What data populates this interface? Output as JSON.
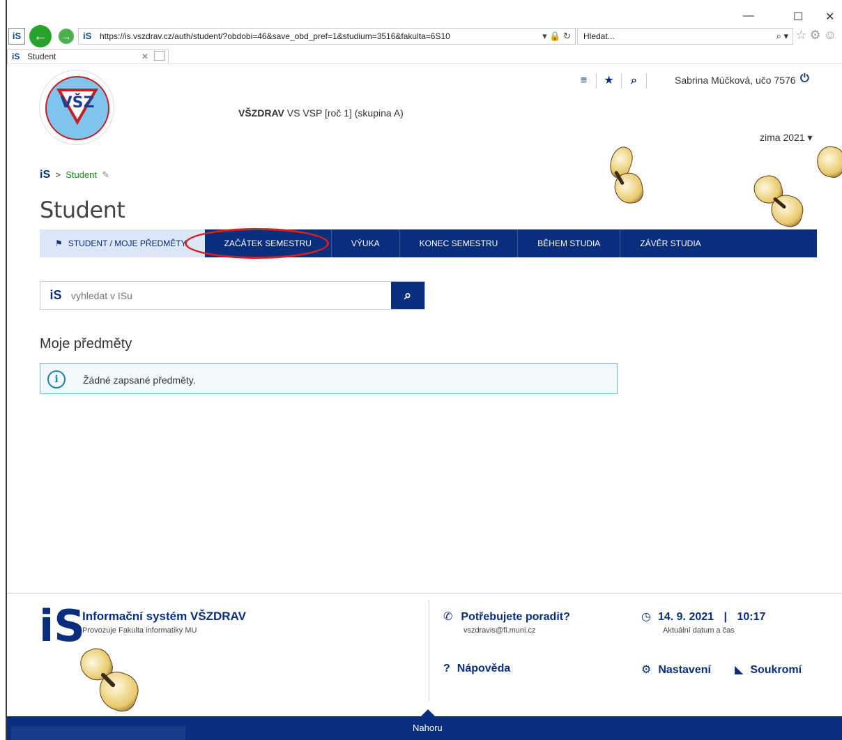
{
  "browser": {
    "url": "https://is.vszdrav.cz/auth/student/?obdobi=46&save_obd_pref=1&studium=3516&fakulta=6S10",
    "search_placeholder": "Hledat...",
    "tab_title": "Student",
    "tab_favicon": "iS"
  },
  "header": {
    "logo_text": "VŠZ",
    "user": "Sabrina Múčková, učo 7576",
    "study_bold": "VŠZDRAV",
    "study_rest": "VS VSP [roč 1] (skupina A)",
    "season": "zima 2021"
  },
  "breadcrumb": {
    "home": "iS",
    "current": "Student"
  },
  "page_title": "Student",
  "nav": {
    "items": [
      {
        "label": "STUDENT / MOJE PŘEDMĚTY",
        "active": true
      },
      {
        "label": "ZAČÁTEK SEMESTRU",
        "active": false
      },
      {
        "label": "VÝUKA",
        "active": false
      },
      {
        "label": "KONEC SEMESTRU",
        "active": false
      },
      {
        "label": "BĚHEM STUDIA",
        "active": false
      },
      {
        "label": "ZÁVĚR STUDIA",
        "active": false
      }
    ]
  },
  "search": {
    "placeholder": "vyhledat v ISu",
    "icon": "iS"
  },
  "section": {
    "title": "Moje předměty",
    "info_text": "Žádné zapsané předměty."
  },
  "footer": {
    "logo": "iS",
    "system_name": "Informační systém VŠZDRAV",
    "operator": "Provozuje Fakulta informatiky MU",
    "help_title": "Potřebujete poradit?",
    "help_email": "vszdravis@fi.muni.cz",
    "date": "14. 9. 2021",
    "time_sep": "|",
    "time": "10:17",
    "date_sub": "Aktuální datum a čas",
    "help_link": "Nápověda",
    "settings_link": "Nastavení",
    "privacy_link": "Soukromí",
    "top_link": "Nahoru"
  },
  "colors": {
    "primary": "#0a2e7e",
    "accent_green": "#18871f",
    "info_border": "#6fb8d6",
    "highlight": "#d42020"
  }
}
